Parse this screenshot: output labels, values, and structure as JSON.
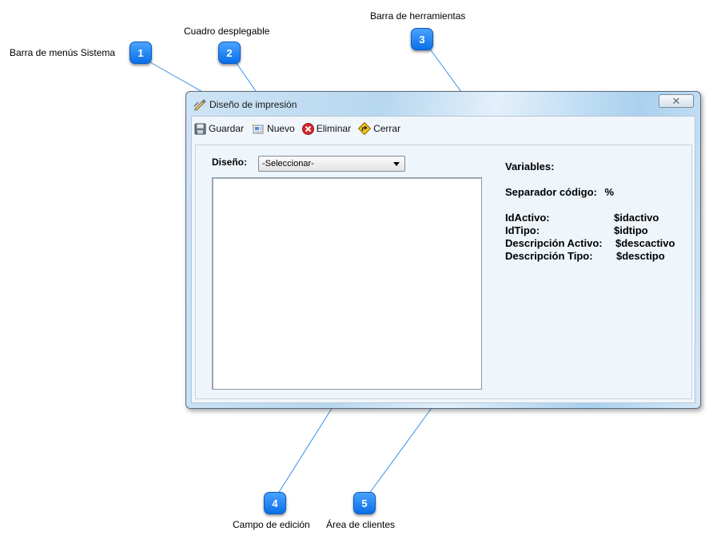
{
  "annotations": [
    {
      "number": "1",
      "label": "Barra de menús Sistema"
    },
    {
      "number": "2",
      "label": "Cuadro desplegable"
    },
    {
      "number": "3",
      "label": "Barra de herramientas"
    },
    {
      "number": "4",
      "label": "Campo de edición"
    },
    {
      "number": "5",
      "label": "Área de clientes"
    }
  ],
  "window": {
    "title": "Diseño de impresión",
    "close_glyph": "✕"
  },
  "toolbar": {
    "save_label": "Guardar",
    "new_label": "Nuevo",
    "delete_label": "Eliminar",
    "close_label": "Cerrar"
  },
  "form": {
    "design_label": "Diseño:",
    "design_selected": "-Seleccionar-",
    "editor_value": ""
  },
  "variables": {
    "heading": "Variables:",
    "separator_label": "Separador código:",
    "separator_value": "%",
    "items": [
      {
        "name": "IdActivo:",
        "token": "$idactivo"
      },
      {
        "name": "IdTipo:",
        "token": "$idtipo"
      },
      {
        "name": "Descripción Activo:",
        "token": "$descactivo"
      },
      {
        "name": "Descripción Tipo:",
        "token": "$desctipo"
      }
    ]
  },
  "colors": {
    "callout": "#0a6fe8",
    "leader_line": "#3b8fe6"
  }
}
